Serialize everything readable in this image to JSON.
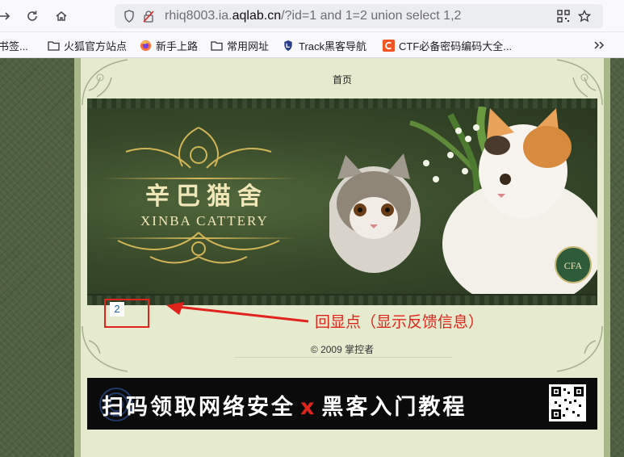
{
  "browser": {
    "url_prefix": "rhiq8003.ia.",
    "url_domain": "aqlab.cn",
    "url_suffix": "/?id=1 and 1=2 union select 1,2",
    "bookmarks": [
      {
        "label": "书签...",
        "icon": "bookmark-icon"
      },
      {
        "label": "火狐官方站点",
        "icon": "folder-icon"
      },
      {
        "label": "新手上路",
        "icon": "firefox-icon"
      },
      {
        "label": "常用网址",
        "icon": "folder-icon"
      },
      {
        "label": "Track黑客导航",
        "icon": "shield-icon"
      },
      {
        "label": "CTF必备密码编码大全...",
        "icon": "c-logo-icon"
      }
    ],
    "accent": "#e0241c"
  },
  "page": {
    "nav_home": "首页",
    "banner_cn": "辛巴猫舍",
    "banner_en": "XINBA CATTERY",
    "echo_value": "2",
    "annotation": "回显点（显示反馈信息）",
    "copyright": "© 2009 掌控者",
    "promo_left": "扫码领取网络安全",
    "promo_x": "x",
    "promo_right": "黑客入门教程"
  }
}
